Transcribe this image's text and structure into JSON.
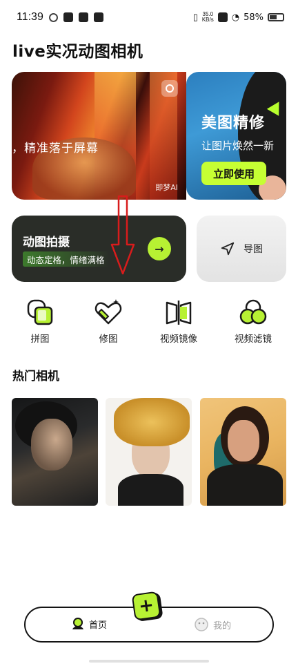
{
  "status_bar": {
    "time": "11:39",
    "net_speed_value": "35.0",
    "net_speed_unit": "KB/s",
    "battery": "58%"
  },
  "app": {
    "title": "live实况动图相机"
  },
  "banner_main": {
    "text": "，精准落于屏幕",
    "brand": "即梦AI"
  },
  "banner_side": {
    "title": "美图精修",
    "subtitle": "让图片焕然一新",
    "cta": "立即使用"
  },
  "card_camera": {
    "title": "动图拍摄",
    "tag": "动态定格，情绪满格"
  },
  "card_nav": {
    "label": "导图"
  },
  "tools": [
    {
      "label": "拼图",
      "icon": "collage-icon"
    },
    {
      "label": "修图",
      "icon": "retouch-icon"
    },
    {
      "label": "视频镜像",
      "icon": "video-mirror-icon"
    },
    {
      "label": "视频滤镜",
      "icon": "video-filter-icon"
    }
  ],
  "section": {
    "title": "热门相机"
  },
  "bottom_nav": {
    "home": "首页",
    "me": "我的"
  },
  "fab": {
    "symbol": "+"
  },
  "colors": {
    "accent_green": "#b7f133",
    "dark_card": "#2a2d28",
    "annotation_red": "#d81c1c"
  }
}
